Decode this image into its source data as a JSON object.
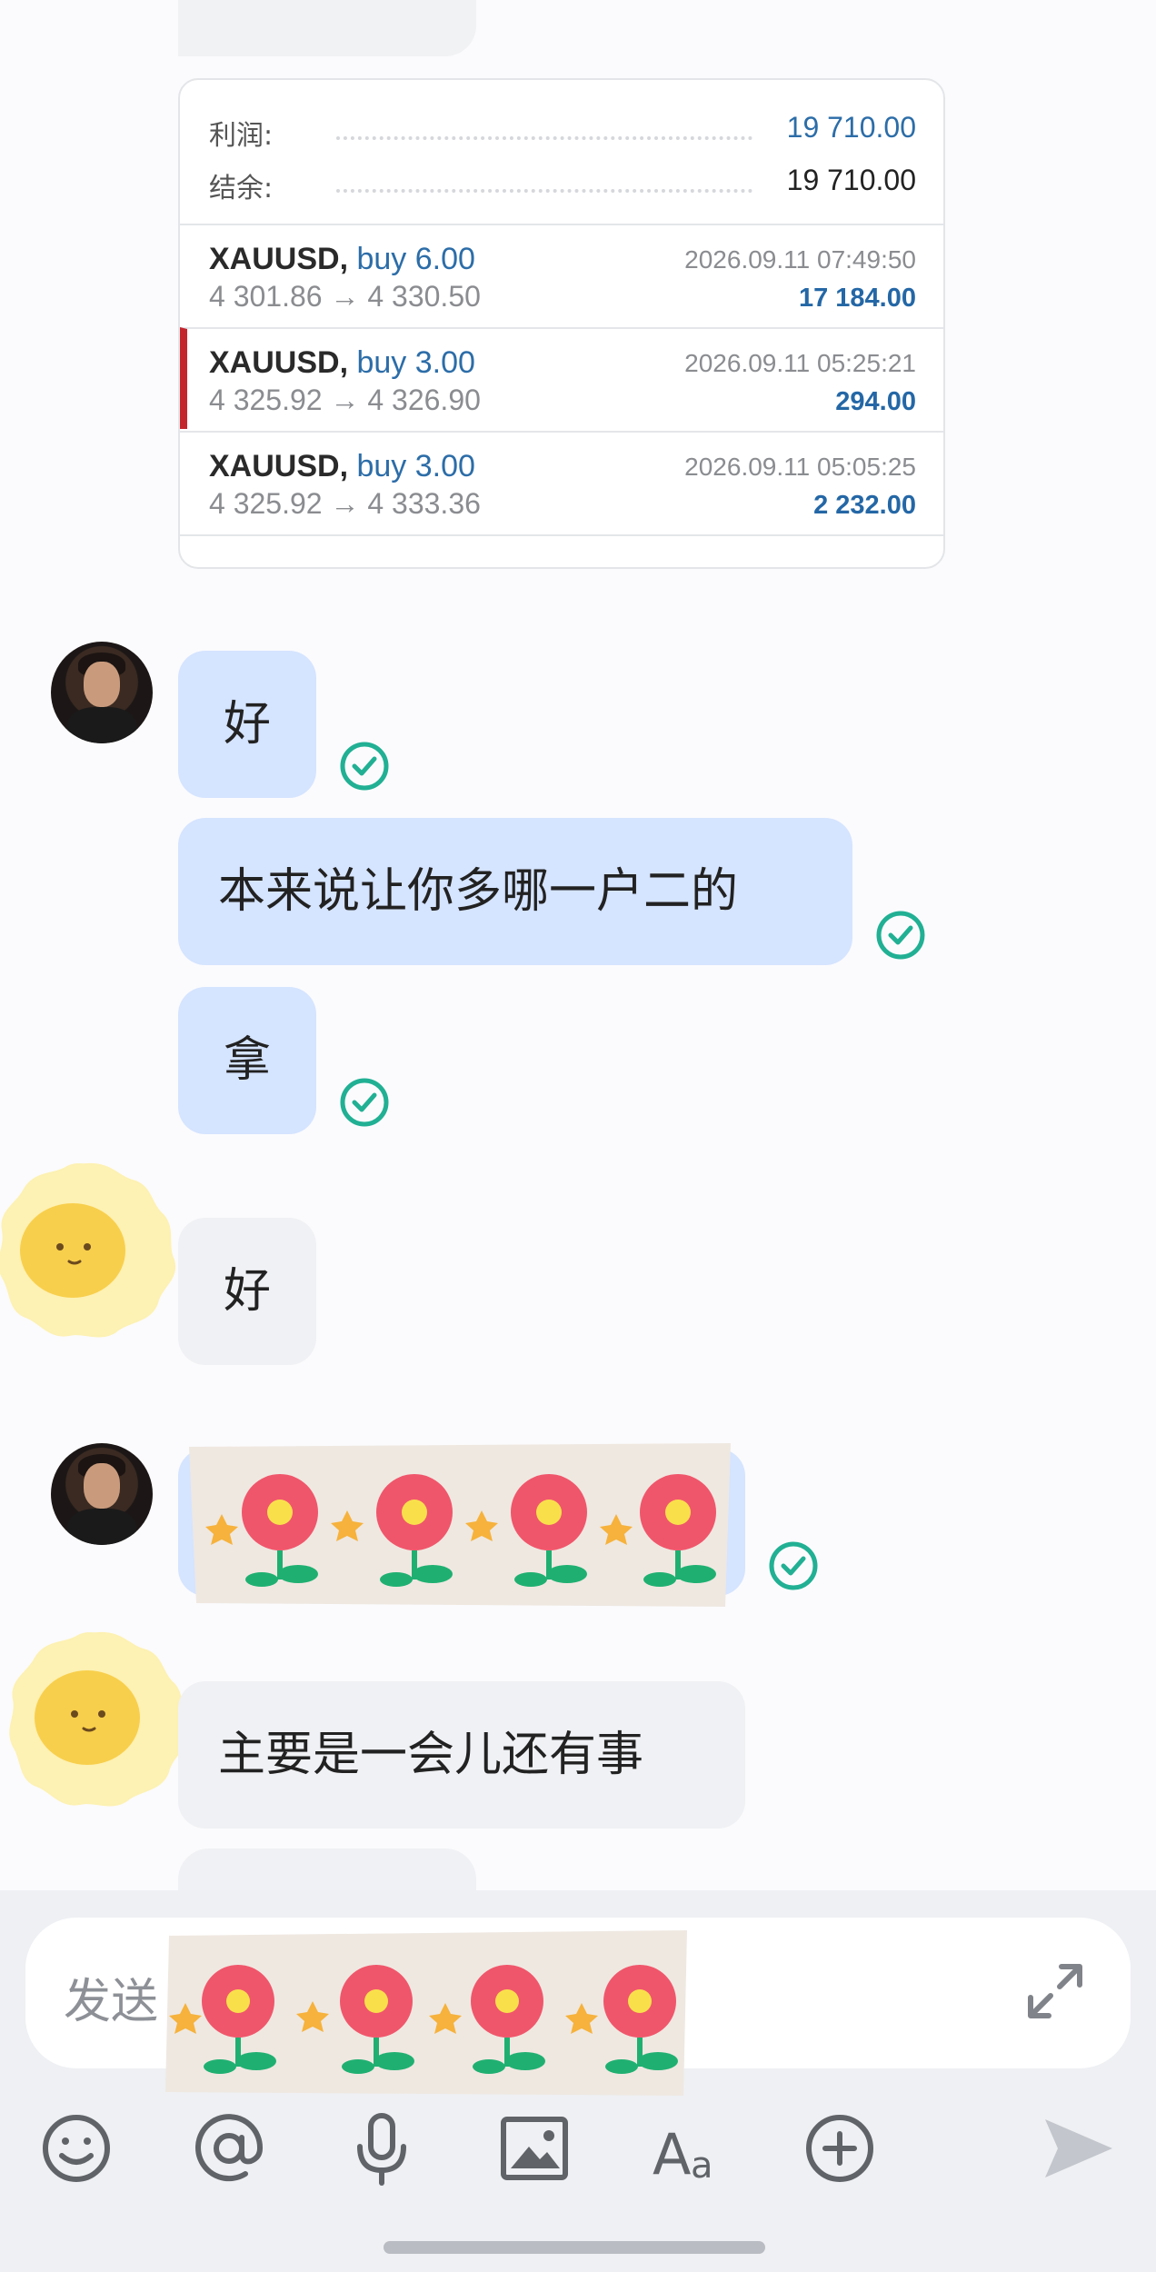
{
  "trade_card": {
    "summary": [
      {
        "label": "利润:",
        "value": "19 710.00",
        "color": "#2c6da8"
      },
      {
        "label": "结余:",
        "value": "19 710.00",
        "color": "#2a2a2a"
      }
    ],
    "trades": [
      {
        "symbol": "XAUUSD,",
        "side": "buy 6.00",
        "prices": "4 301.86 → 4 330.50",
        "time": "2026.09.11 07:49:50",
        "profit": "17 184.00"
      },
      {
        "symbol": "XAUUSD,",
        "side": "buy 3.00",
        "prices": "4 325.92 → 4 326.90",
        "time": "2026.09.11 05:25:21",
        "profit": "294.00"
      },
      {
        "symbol": "XAUUSD,",
        "side": "buy 3.00",
        "prices": "4 325.92 → 4 333.36",
        "time": "2026.09.11 05:05:25",
        "profit": "2 232.00"
      }
    ]
  },
  "messages": [
    {
      "sender": "self",
      "text": "好",
      "status": "read-check-icon"
    },
    {
      "sender": "self",
      "text": "本来说让你多哪一户二的",
      "status": "read-check-icon"
    },
    {
      "sender": "self",
      "text": "拿",
      "status": "read-check-icon"
    },
    {
      "sender": "other",
      "text": "好"
    },
    {
      "sender": "self",
      "sticker": "flower-sticker",
      "status": "read-check-icon"
    },
    {
      "sender": "other",
      "text": "主要是一会儿还有事"
    }
  ],
  "composer": {
    "placeholder": "发送",
    "expand_icon": "expand-icon",
    "toolbar": [
      "emoji-icon",
      "mention-icon",
      "microphone-icon",
      "image-icon",
      "text-format-icon",
      "add-icon",
      "send-icon"
    ]
  },
  "colors": {
    "self_bubble": "#d5e4ff",
    "other_bubble": "#f0f1f4",
    "check": "#21b094",
    "send_disabled": "#c3c6cc"
  }
}
